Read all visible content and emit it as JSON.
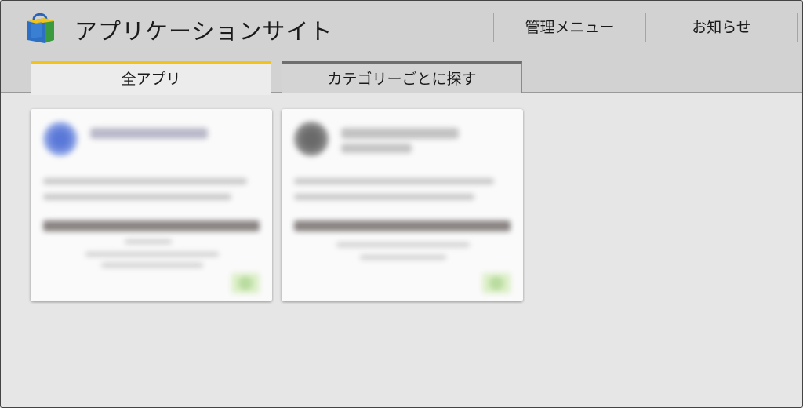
{
  "header": {
    "app_title": "アプリケーションサイト",
    "nav": {
      "admin_menu": "管理メニュー",
      "notices": "お知らせ"
    }
  },
  "tabs": [
    {
      "label": "全アプリ",
      "active": true
    },
    {
      "label": "カテゴリーごとに探す",
      "active": false
    }
  ],
  "colors": {
    "active_tab_accent": "#f2c318",
    "inactive_tab_accent": "#6e6e6e",
    "header_bg": "#d2d2d2",
    "content_bg": "#e6e6e6"
  },
  "cards_note_icons": [
    "shopping-bag-logo-icon"
  ]
}
